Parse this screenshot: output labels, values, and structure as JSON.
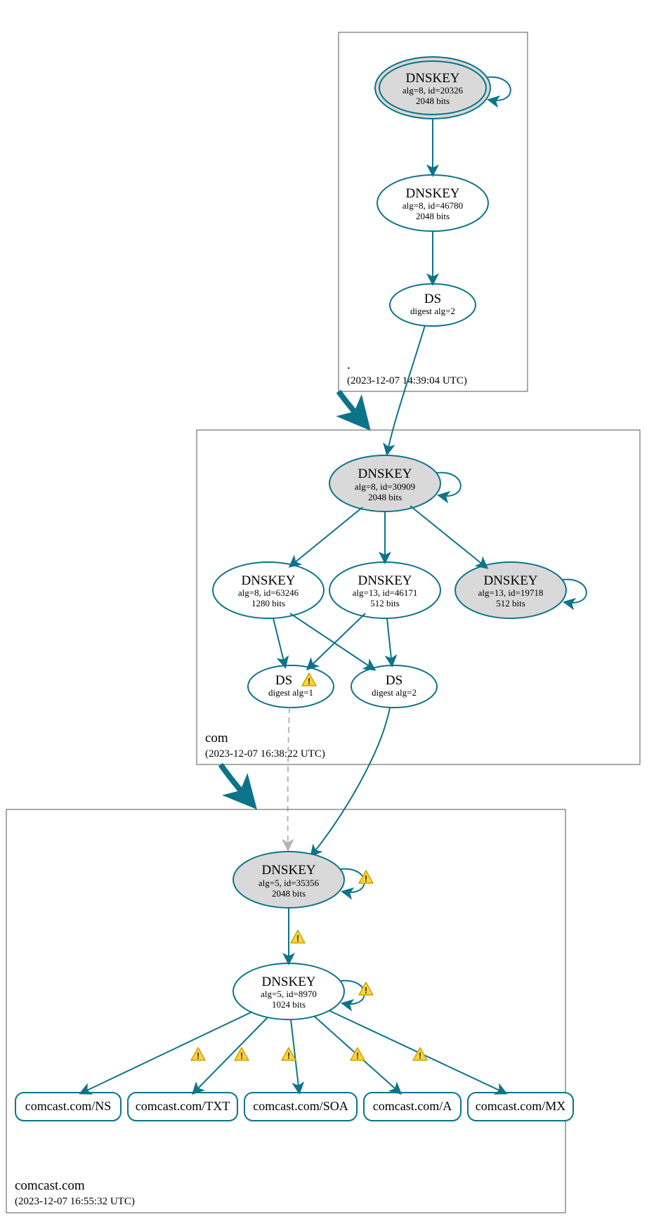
{
  "zones": {
    "root": {
      "label": ".",
      "timestamp": "(2023-12-07 14:39:04 UTC)"
    },
    "com": {
      "label": "com",
      "timestamp": "(2023-12-07 16:38:22 UTC)"
    },
    "comcast": {
      "label": "comcast.com",
      "timestamp": "(2023-12-07 16:55:32 UTC)"
    }
  },
  "nodes": {
    "root_ksk": {
      "title": "DNSKEY",
      "line1": "alg=8, id=20326",
      "line2": "2048 bits"
    },
    "root_zsk": {
      "title": "DNSKEY",
      "line1": "alg=8, id=46780",
      "line2": "2048 bits"
    },
    "root_ds": {
      "title": "DS",
      "line1": "digest alg=2",
      "line2": ""
    },
    "com_ksk": {
      "title": "DNSKEY",
      "line1": "alg=8, id=30909",
      "line2": "2048 bits"
    },
    "com_zsk1": {
      "title": "DNSKEY",
      "line1": "alg=8, id=63246",
      "line2": "1280 bits"
    },
    "com_zsk2": {
      "title": "DNSKEY",
      "line1": "alg=13, id=46171",
      "line2": "512 bits"
    },
    "com_zsk3": {
      "title": "DNSKEY",
      "line1": "alg=13, id=19718",
      "line2": "512 bits"
    },
    "com_ds1": {
      "title": "DS",
      "line1": "digest alg=1",
      "line2": ""
    },
    "com_ds2": {
      "title": "DS",
      "line1": "digest alg=2",
      "line2": ""
    },
    "cc_ksk": {
      "title": "DNSKEY",
      "line1": "alg=5, id=35356",
      "line2": "2048 bits"
    },
    "cc_zsk": {
      "title": "DNSKEY",
      "line1": "alg=5, id=8970",
      "line2": "1024 bits"
    }
  },
  "rrsets": {
    "ns": "comcast.com/NS",
    "txt": "comcast.com/TXT",
    "soa": "comcast.com/SOA",
    "a": "comcast.com/A",
    "mx": "comcast.com/MX"
  }
}
